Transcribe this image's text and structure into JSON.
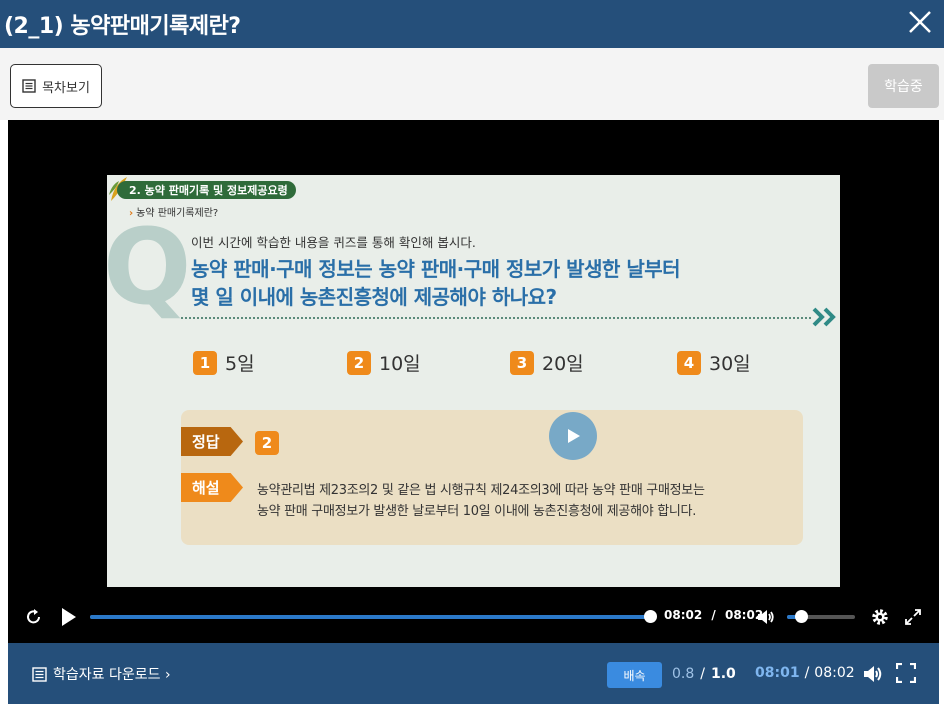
{
  "window": {
    "title": "(2_1) 농약판매기록제란?"
  },
  "toolbar": {
    "toc_label": "목차보기",
    "status_label": "학습중"
  },
  "slide": {
    "section_title": "2. 농약 판매기록 및 정보제공요령",
    "subsection": "농약 판매기록제란?",
    "big_letter": "Q",
    "intro": "이번 시간에 학습한 내용을 퀴즈를 통해 확인해 봅시다.",
    "question_line1": "농약 판매·구매 정보는 농약 판매·구매 정보가 발생한 날부터",
    "question_line2": "몇 일 이내에 농촌진흥청에 제공해야 하나요?",
    "options": [
      {
        "num": "1",
        "text": "5일"
      },
      {
        "num": "2",
        "text": "10일"
      },
      {
        "num": "3",
        "text": "20일"
      },
      {
        "num": "4",
        "text": "30일"
      }
    ],
    "answer_label": "정답",
    "answer_value": "2",
    "explanation_label": "해설",
    "explanation_line1": "농약관리법 제23조의2 및 같은 법 시행규칙 제24조의3에 따라 농약 판매 구매정보는",
    "explanation_line2": "농약 판매 구매정보가 발생한 날로부터 10일 이내에 농촌진흥청에 제공해야 합니다."
  },
  "player": {
    "current_time": "08:02",
    "sep": "/",
    "duration": "08:02",
    "progress": 1.0,
    "volume": 0.2
  },
  "bottom": {
    "download_label": "학습자료 다운로드 ›",
    "speed_button": "배속",
    "speed_current": "0.8",
    "speed_sep": "/",
    "speed_max": "1.0",
    "time_current": "08:01",
    "time_sep": "/",
    "time_total": "08:02"
  },
  "colors": {
    "header": "#254f7a",
    "accent_orange": "#ef8a1b",
    "question_blue": "#2a6fa8",
    "progress_blue": "#2b79c9"
  }
}
